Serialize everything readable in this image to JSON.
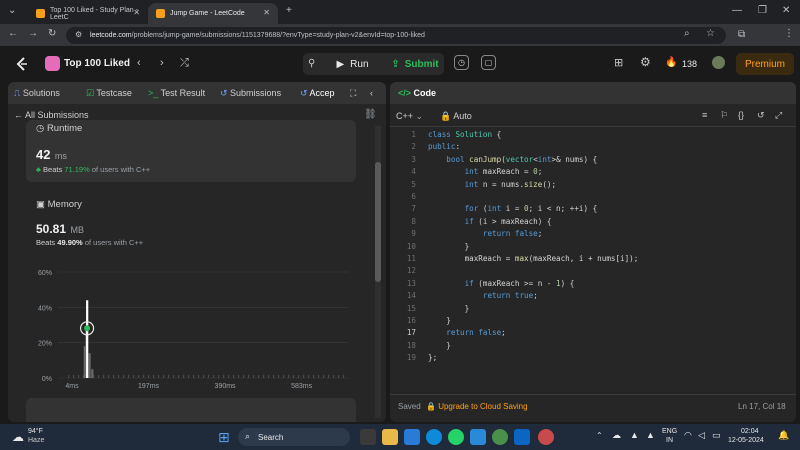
{
  "browser": {
    "tabs": [
      {
        "title": "Top 100 Liked - Study Plan - LeetC"
      },
      {
        "title": "Jump Game - LeetCode"
      }
    ],
    "url_host": "leetcode.com",
    "url_path": "/problems/jump-game/submissions/1151379688/?envType=study-plan-v2&envId=top-100-liked"
  },
  "header": {
    "list_title": "Top 100 Liked",
    "run_label": "Run",
    "submit_label": "Submit",
    "streak": "138",
    "premium_label": "Premium"
  },
  "left": {
    "tabs": [
      "Solutions",
      "Testcase",
      "Test Result",
      "Submissions",
      "Accep"
    ],
    "back_label": "All Submissions",
    "runtime": {
      "title": "Runtime",
      "value": "42",
      "unit": "ms",
      "beats_label": "Beats",
      "beats_pct": "71.19%",
      "beats_suffix": "of users with C++"
    },
    "memory": {
      "title": "Memory",
      "value": "50.81",
      "unit": "MB",
      "beats_label": "Beats",
      "beats_pct": "49.90%",
      "beats_suffix": "of users with C++"
    }
  },
  "chart_data": {
    "type": "bar",
    "title": "",
    "ylabel": "",
    "xlabel": "",
    "y_ticks": [
      "60%",
      "40%",
      "20%",
      "0%"
    ],
    "x_ticks": [
      "4ms",
      "197ms",
      "390ms",
      "583ms"
    ],
    "ylim": [
      0,
      60
    ],
    "highlight_runtime": "42ms",
    "bars": [
      {
        "runtime_ms": 36,
        "percent": 18
      },
      {
        "runtime_ms": 40,
        "percent": 27
      },
      {
        "runtime_ms": 42,
        "percent": 44
      },
      {
        "runtime_ms": 48,
        "percent": 14
      },
      {
        "runtime_ms": 55,
        "percent": 5
      }
    ]
  },
  "editor": {
    "title": "Code",
    "language": "C++",
    "auto_label": "Auto",
    "lines": [
      {
        "n": "1",
        "text": "class Solution {"
      },
      {
        "n": "2",
        "text": "public:"
      },
      {
        "n": "3",
        "text": "    bool canJump(vector<int>& nums) {"
      },
      {
        "n": "4",
        "text": "        int maxReach = 0;"
      },
      {
        "n": "5",
        "text": "        int n = nums.size();"
      },
      {
        "n": "6",
        "text": ""
      },
      {
        "n": "7",
        "text": "        for (int i = 0; i < n; ++i) {"
      },
      {
        "n": "8",
        "text": "        if (i > maxReach) {"
      },
      {
        "n": "9",
        "text": "            return false;"
      },
      {
        "n": "10",
        "text": "        }"
      },
      {
        "n": "11",
        "text": "        maxReach = max(maxReach, i + nums[i]);"
      },
      {
        "n": "12",
        "text": ""
      },
      {
        "n": "13",
        "text": "        if (maxReach >= n - 1) {"
      },
      {
        "n": "14",
        "text": "            return true;"
      },
      {
        "n": "15",
        "text": "        }"
      },
      {
        "n": "16",
        "text": "    }"
      },
      {
        "n": "17",
        "text": "    return false;"
      },
      {
        "n": "18",
        "text": "    }"
      },
      {
        "n": "19",
        "text": "};"
      }
    ],
    "saved_label": "Saved",
    "upgrade_label": "Upgrade to Cloud Saving",
    "cursor_pos": "Ln 17, Col 18"
  },
  "taskbar": {
    "weather_temp": "94°F",
    "weather_desc": "Haze",
    "search_label": "Search",
    "lang_line1": "ENG",
    "lang_line2": "IN",
    "time": "02:04",
    "date": "12-05-2024"
  },
  "colors": {
    "accent_green": "#2cbb5d",
    "accent_orange": "#ffa116",
    "bg": "#1a1a1a"
  }
}
